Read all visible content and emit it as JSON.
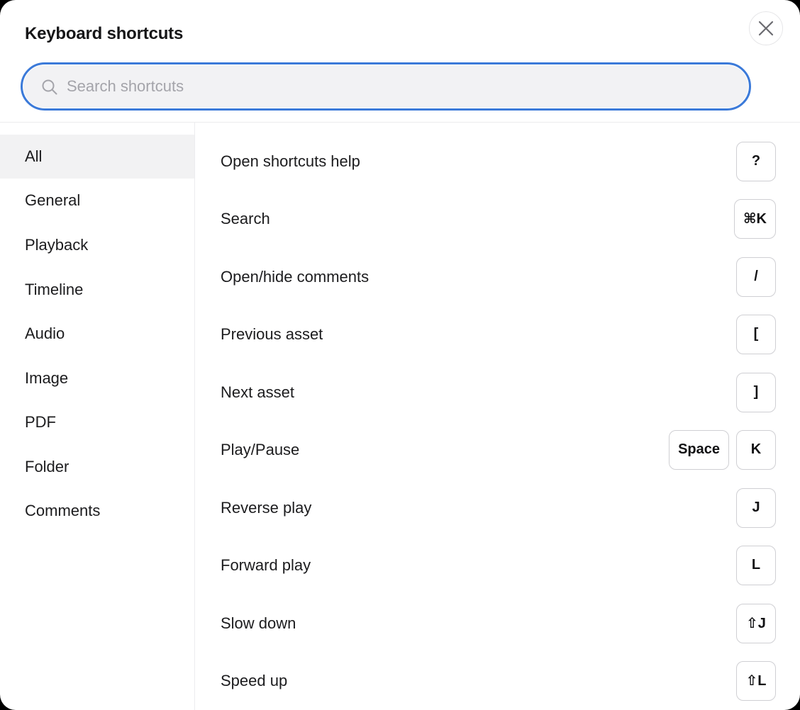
{
  "dialog": {
    "title": "Keyboard shortcuts",
    "close_icon": "close-icon"
  },
  "search": {
    "placeholder": "Search shortcuts",
    "value": "",
    "icon": "search-icon",
    "focus_color": "#3b7ad9"
  },
  "sidebar": {
    "active": "All",
    "items": [
      {
        "label": "All"
      },
      {
        "label": "General"
      },
      {
        "label": "Playback"
      },
      {
        "label": "Timeline"
      },
      {
        "label": "Audio"
      },
      {
        "label": "Image"
      },
      {
        "label": "PDF"
      },
      {
        "label": "Folder"
      },
      {
        "label": "Comments"
      }
    ]
  },
  "shortcuts": [
    {
      "label": "Open shortcuts help",
      "keys": [
        "?"
      ]
    },
    {
      "label": "Search",
      "keys": [
        "⌘K"
      ]
    },
    {
      "label": "Open/hide comments",
      "keys": [
        "/"
      ]
    },
    {
      "label": "Previous asset",
      "keys": [
        "["
      ]
    },
    {
      "label": "Next asset",
      "keys": [
        "]"
      ]
    },
    {
      "label": "Play/Pause",
      "keys": [
        "Space",
        "K"
      ]
    },
    {
      "label": "Reverse play",
      "keys": [
        "J"
      ]
    },
    {
      "label": "Forward play",
      "keys": [
        "L"
      ]
    },
    {
      "label": "Slow down",
      "keys": [
        "⇧J"
      ]
    },
    {
      "label": "Speed up",
      "keys": [
        "⇧L"
      ]
    }
  ]
}
